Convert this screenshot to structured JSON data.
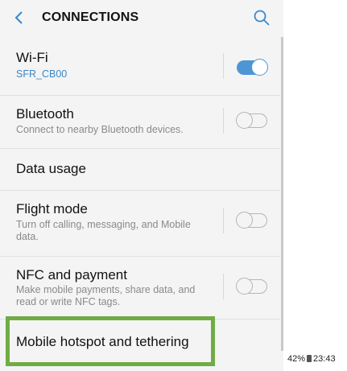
{
  "header": {
    "title": "CONNECTIONS",
    "back_icon": "back-arrow-icon",
    "search_icon": "search-icon"
  },
  "rows": [
    {
      "title": "Wi-Fi",
      "subtitle": "SFR_CB00",
      "toggle": true
    },
    {
      "title": "Bluetooth",
      "subtitle": "Connect to nearby Bluetooth devices.",
      "toggle": false
    },
    {
      "title": "Data usage"
    },
    {
      "title": "Flight mode",
      "subtitle": "Turn off calling, messaging, and Mobile data.",
      "toggle": false
    },
    {
      "title": "NFC and payment",
      "subtitle": "Make mobile payments, share data, and read or write NFC tags.",
      "toggle": false
    },
    {
      "title": "Mobile hotspot and tethering"
    }
  ],
  "status_bar": {
    "battery": "42%",
    "time": "23:43"
  },
  "colors": {
    "accent": "#4d96d6",
    "highlight": "#6fac45",
    "background": "#f4f4f4"
  }
}
